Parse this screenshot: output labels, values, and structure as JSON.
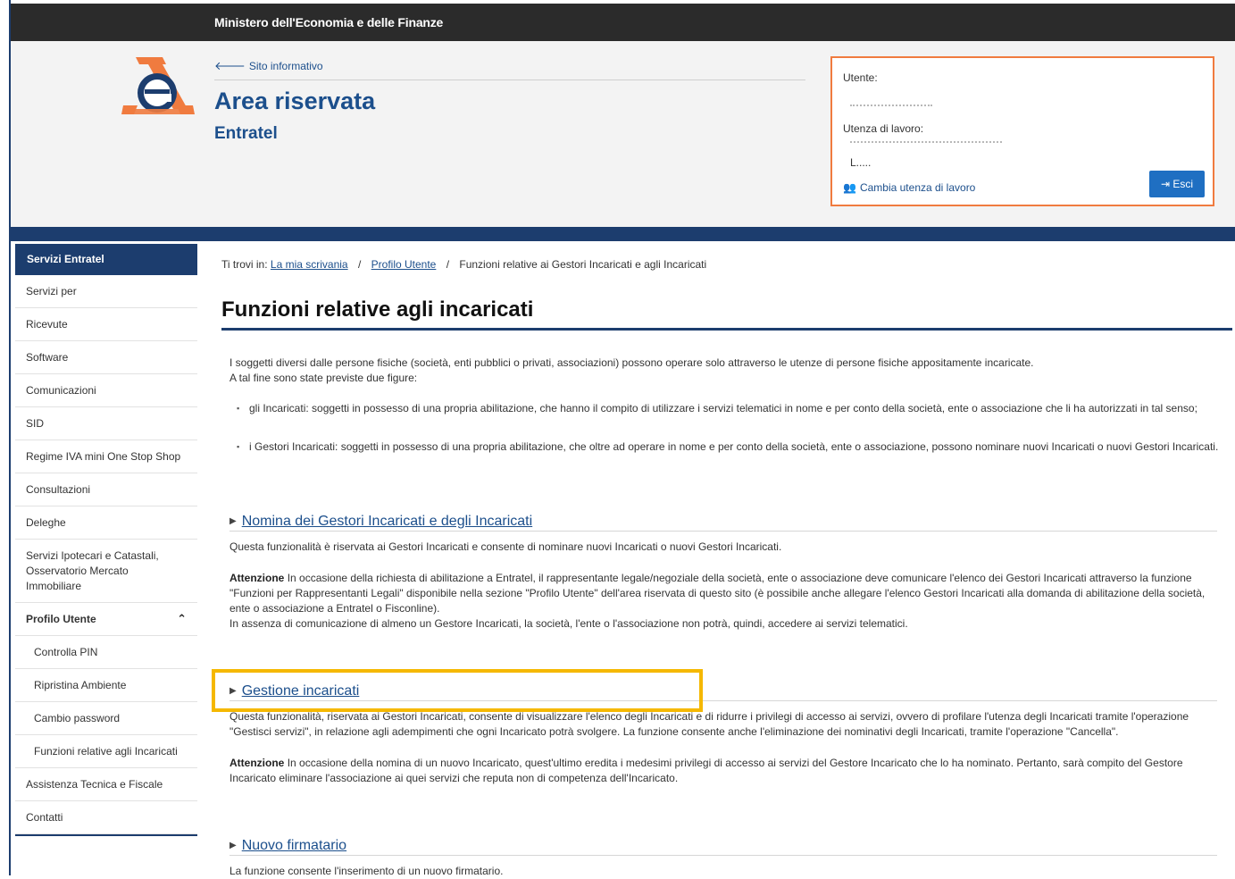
{
  "topbar": {
    "ministry": "Ministero dell'Economia e delle Finanze"
  },
  "header": {
    "back_link": "Sito informativo",
    "title": "Area riservata",
    "subtitle": "Entratel"
  },
  "user_box": {
    "utente_label": "Utente:",
    "utenza_label": "Utenza di lavoro:",
    "small_value": "L.....",
    "cambia_label": "Cambia utenza di lavoro",
    "esci_label": "Esci"
  },
  "sidebar": {
    "header": "Servizi Entratel",
    "items": [
      "Servizi per",
      "Ricevute",
      "Software",
      "Comunicazioni",
      "SID",
      "Regime IVA mini One Stop Shop",
      "Consultazioni",
      "Deleghe",
      "Servizi Ipotecari e Catastali, Osservatorio Mercato Immobiliare"
    ],
    "profilo": "Profilo Utente",
    "subitems": [
      "Controlla PIN",
      "Ripristina Ambiente",
      "Cambio password",
      "Funzioni relative agli Incaricati"
    ],
    "bottom_items": [
      "Assistenza Tecnica e Fiscale",
      "Contatti"
    ]
  },
  "breadcrumb": {
    "prefix": "Ti trovi in:",
    "link1": "La mia scrivania",
    "sep": "/",
    "link2": "Profilo Utente",
    "current": "Funzioni relative ai Gestori Incaricati e agli Incaricati"
  },
  "content": {
    "title": "Funzioni relative agli incaricati",
    "intro1": "I soggetti diversi dalle persone fisiche (società, enti pubblici o privati, associazioni) possono operare solo attraverso le utenze di persone fisiche appositamente incaricate.",
    "intro2": "A tal fine sono state previste due figure:",
    "bullet1": "gli Incaricati: soggetti in possesso di una propria abilitazione, che hanno il compito di utilizzare i servizi telematici in nome e per conto della società, ente o associazione che li ha autorizzati in tal senso;",
    "bullet2": "i Gestori Incaricati: soggetti in possesso di una propria abilitazione, che oltre ad operare in nome e per conto della società, ente o associazione, possono nominare nuovi Incaricati o nuovi Gestori Incaricati.",
    "section1": {
      "title": "Nomina dei Gestori Incaricati e degli Incaricati",
      "desc": "Questa funzionalità è riservata ai Gestori Incaricati e consente di nominare nuovi Incaricati o nuovi Gestori Incaricati.",
      "att_label": "Attenzione",
      "att_text": "In occasione della richiesta di abilitazione a Entratel, il rappresentante legale/negoziale della società, ente o associazione deve comunicare l'elenco dei Gestori Incaricati attraverso la funzione \"Funzioni per Rappresentanti Legali\" disponibile nella sezione \"Profilo Utente\" dell'area riservata di questo sito (è possibile anche allegare l'elenco Gestori Incaricati alla domanda di abilitazione della società, ente o associazione a Entratel o Fisconline).",
      "att_text2": "In assenza di comunicazione di almeno un Gestore Incaricati, la società, l'ente o l'associazione non potrà, quindi, accedere ai servizi telematici."
    },
    "section2": {
      "title": "Gestione incaricati",
      "desc": "Questa funzionalità, riservata ai Gestori Incaricati, consente di visualizzare l'elenco degli Incaricati e di ridurre i privilegi di accesso ai servizi, ovvero di profilare l'utenza degli Incaricati tramite l'operazione \"Gestisci servizi\", in relazione agli adempimenti che ogni Incaricato potrà svolgere. La funzione consente anche l'eliminazione dei nominativi degli Incaricati, tramite l'operazione \"Cancella\".",
      "att_label": "Attenzione",
      "att_text": "In occasione della nomina di un nuovo Incaricato, quest'ultimo eredita i medesimi privilegi di accesso ai servizi del Gestore Incaricato che lo ha nominato. Pertanto, sarà compito del Gestore Incaricato eliminare l'associazione ai quei servizi che reputa non di competenza dell'Incaricato."
    },
    "section3": {
      "title": "Nuovo firmatario",
      "desc": "La funzione consente l'inserimento di un nuovo firmatario."
    }
  },
  "colors": {
    "brand_blue": "#1c3d6e",
    "link_blue": "#1c4f8c",
    "accent_orange": "#f07b3f",
    "highlight_yellow": "#f5b800"
  }
}
